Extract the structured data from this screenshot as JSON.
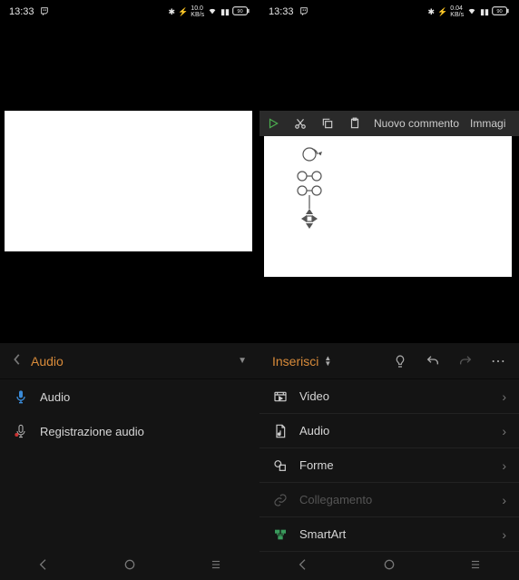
{
  "status_left": {
    "time": "13:33",
    "kbs": "10.0",
    "unit": "KB/s"
  },
  "status_right": {
    "time": "13:33",
    "kbs": "0.04",
    "unit": "KB/s"
  },
  "toolbar_right": {
    "new_comment": "Nuovo commento",
    "image": "Immagi"
  },
  "panel_left": {
    "title": "Audio",
    "items": [
      {
        "label": "Audio"
      },
      {
        "label": "Registrazione audio"
      }
    ]
  },
  "panel_right": {
    "title": "Inserisci",
    "items": [
      {
        "label": "Video"
      },
      {
        "label": "Audio"
      },
      {
        "label": "Forme"
      },
      {
        "label": "Collegamento",
        "disabled": true
      },
      {
        "label": "SmartArt"
      }
    ]
  }
}
